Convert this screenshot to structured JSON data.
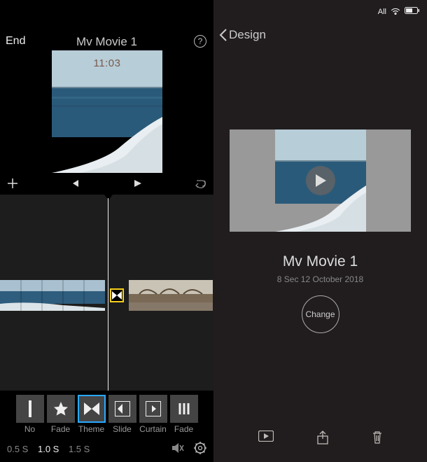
{
  "editor": {
    "end_label": "End",
    "title": "Mv Movie 1",
    "help_label": "?",
    "timecode": "11:03",
    "transitions": {
      "items": [
        {
          "label": "No"
        },
        {
          "label": "Fade"
        },
        {
          "label": "Theme"
        },
        {
          "label": "Slide"
        },
        {
          "label": "Curtain"
        },
        {
          "label": "Fade"
        }
      ],
      "selected_index": 2
    },
    "durations": {
      "options": [
        "0.5 S",
        "1.0 S",
        "1.5 S"
      ],
      "selected": "1.0 S"
    }
  },
  "project": {
    "back_label": "Design",
    "status": {
      "mode": "All"
    },
    "title": "Mv Movie 1",
    "meta": "8 Sec 12 October 2018",
    "change_label": "Change"
  }
}
